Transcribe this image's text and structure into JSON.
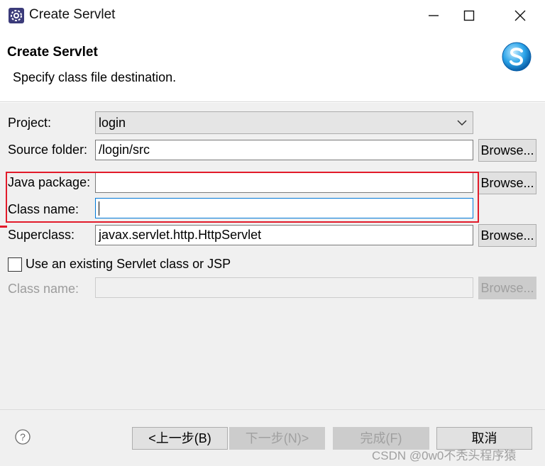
{
  "window": {
    "title": "Create Servlet",
    "icons": {
      "app": "eclipse-gear-icon",
      "minimize": "minimize-icon",
      "maximize": "maximize-icon",
      "close": "close-icon"
    }
  },
  "header": {
    "title": "Create Servlet",
    "description": "Specify class file destination.",
    "logo_icon": "servlet-s-logo-icon"
  },
  "form": {
    "project": {
      "label": "Project:",
      "value": "login"
    },
    "source_folder": {
      "label": "Source folder:",
      "value": "/login/src",
      "browse": "Browse..."
    },
    "java_package": {
      "label": "Java package:",
      "value": "",
      "browse": "Browse..."
    },
    "class_name": {
      "label": "Class name:",
      "value": ""
    },
    "superclass": {
      "label": "Superclass:",
      "value": "javax.servlet.http.HttpServlet",
      "browse": "Browse..."
    },
    "use_existing": {
      "label": "Use an existing Servlet class or JSP",
      "checked": false
    },
    "existing_class_name": {
      "label": "Class name:",
      "value": "",
      "browse": "Browse..."
    }
  },
  "footer": {
    "help_icon": "help-question-icon",
    "back": "<上一步(B)",
    "next": "下一步(N)>",
    "finish": "完成(F)",
    "cancel": "取消"
  },
  "watermark": "CSDN @0w0不秃头程序猿",
  "colors": {
    "highlight_border": "#e21b2a",
    "focus_border": "#0078d7",
    "dialog_bg": "#f0f0f0"
  }
}
